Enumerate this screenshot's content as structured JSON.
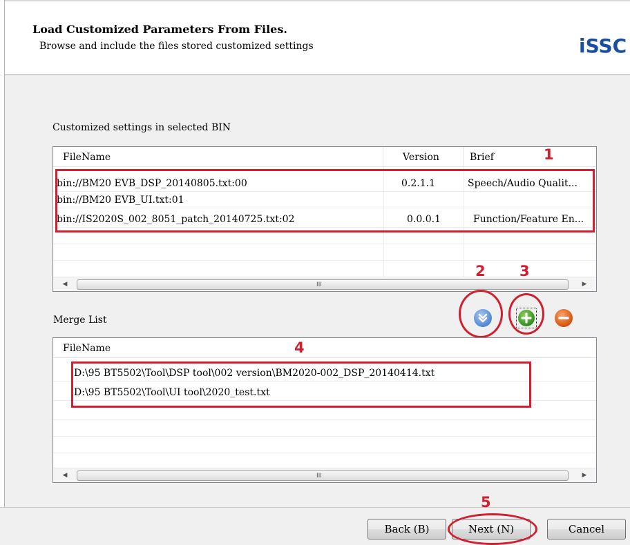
{
  "header": {
    "title": "Load Customized Parameters From Files.",
    "subtitle": "Browse and include the files stored customized settings",
    "logo": "iSSC"
  },
  "bin_section": {
    "label": "Customized settings in selected BIN",
    "columns": [
      "FileName",
      "Version",
      "Brief"
    ],
    "rows": [
      {
        "filename": "bin://BM20 EVB_DSP_20140805.txt:00",
        "version": "0.2.1.1",
        "brief": "Speech/Audio Qualit..."
      },
      {
        "filename": "bin://BM20 EVB_UI.txt:01",
        "version": "",
        "brief": ""
      },
      {
        "filename": "bin://IS2020S_002_8051_patch_20140725.txt:02",
        "version": "0.0.0.1",
        "brief": "Function/Feature En..."
      }
    ]
  },
  "merge_section": {
    "label": "Merge List",
    "columns": [
      "FileName"
    ],
    "rows": [
      {
        "filename": "D:\\95 BT5502\\Tool\\DSP tool\\002 version\\BM2020-002_DSP_20140414.txt"
      },
      {
        "filename": "D:\\95 BT5502\\Tool\\UI tool\\2020_test.txt"
      }
    ]
  },
  "scrollbar_grip": "III",
  "annotations": {
    "n1": "1",
    "n2": "2",
    "n3": "3",
    "n4": "4",
    "n5": "5",
    "color": "#d01f2e"
  },
  "icons": {
    "move_down": "double-chevron-down-icon",
    "add": "plus-icon",
    "remove": "minus-icon"
  },
  "footer": {
    "back_label": "Back (B)",
    "next_label": "Next (N)",
    "cancel_label": "Cancel"
  }
}
